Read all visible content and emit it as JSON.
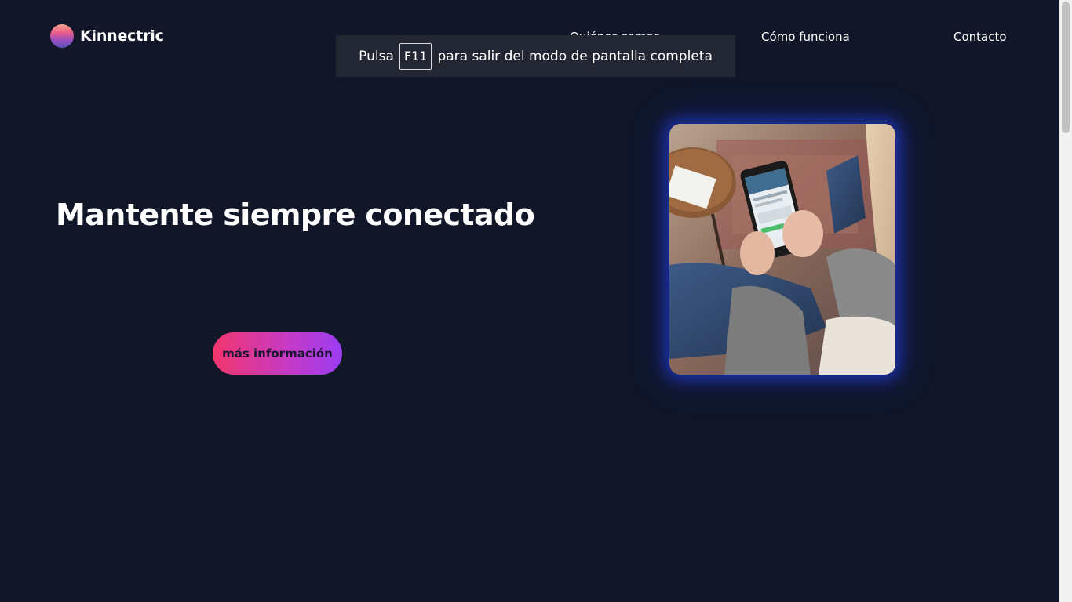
{
  "brand": {
    "name": "Kinnectric"
  },
  "nav": {
    "items": [
      "Quiénes somos",
      "Cómo funciona",
      "Contacto"
    ]
  },
  "fullscreen_notice": {
    "before": "Pulsa",
    "key": "F11",
    "after": "para salir del modo de pantalla completa"
  },
  "hero": {
    "title": "Mantente siempre conectado",
    "cta_label": "más información"
  },
  "colors": {
    "background": "#111729",
    "accent_start": "#f2366d",
    "accent_end": "#9b3df2",
    "glow": "#2846ff"
  }
}
